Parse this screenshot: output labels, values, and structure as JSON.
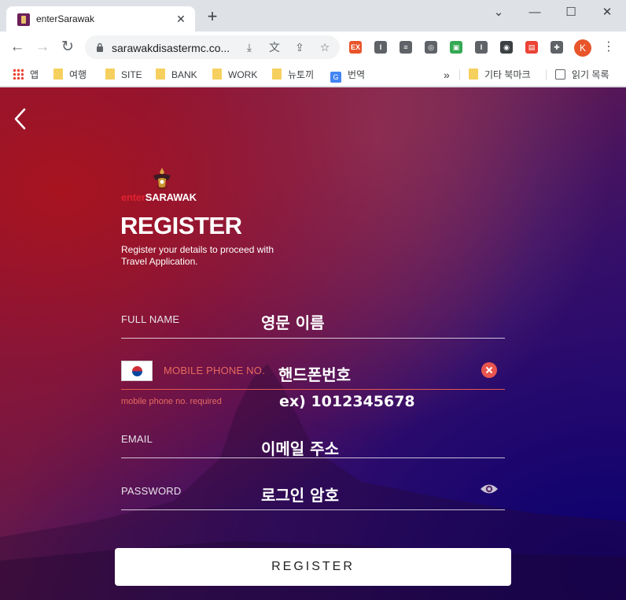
{
  "browser": {
    "tab_title": "enterSarawak",
    "tab_close": "✕",
    "new_tab": "+",
    "url": "sarawakdisastermc.co...",
    "window_minimize": "—",
    "window_maximize": "☐",
    "window_close": "✕",
    "profile_initial": "K",
    "extensions": [
      {
        "icon": "ex-icon",
        "label": "EX",
        "color": "#e8552b"
      },
      {
        "icon": "i-icon",
        "label": "I",
        "color": "#5f6368"
      },
      {
        "icon": "list-icon",
        "label": "≡",
        "color": "#5f6368"
      },
      {
        "icon": "film-icon",
        "label": "◎",
        "color": "#5f6368"
      },
      {
        "icon": "screen-icon",
        "label": "▣",
        "color": "#34a853"
      },
      {
        "icon": "i2-icon",
        "label": "I",
        "color": "#5f6368"
      },
      {
        "icon": "helmet-icon",
        "label": "◉",
        "color": "#3c4043"
      },
      {
        "icon": "cast-icon",
        "label": "▤",
        "color": "#ea4335"
      },
      {
        "icon": "puzzle-icon",
        "label": "✚",
        "color": "#5f6368"
      }
    ]
  },
  "bookmarks": {
    "items": [
      {
        "label": "앱",
        "icon": "apps-icon"
      },
      {
        "label": "여행",
        "icon": "folder-icon"
      },
      {
        "label": "SITE",
        "icon": "folder-icon"
      },
      {
        "label": "BANK",
        "icon": "folder-icon"
      },
      {
        "label": "WORK",
        "icon": "folder-icon"
      },
      {
        "label": "뉴토끼",
        "icon": "folder-icon"
      },
      {
        "label": "번역",
        "icon": "translate-icon"
      }
    ],
    "overflow": "»",
    "other_bookmarks": "기타 북마크",
    "reading_list": "읽기 목록"
  },
  "page": {
    "logo_enter": "enter",
    "logo_sarawak": "SARAWAK",
    "title": "REGISTER",
    "subtitle": "Register your details to proceed with Travel Application.",
    "full_name": {
      "label": "FULL NAME",
      "value": "영문 이름"
    },
    "mobile": {
      "label": "MOBILE PHONE NO.",
      "value": "핸드폰번호",
      "error": "mobile phone no. required",
      "hint": "ex) 1012345678",
      "country": "KR"
    },
    "email": {
      "label": "EMAIL",
      "value": "이메일 주소"
    },
    "password": {
      "label": "PASSWORD",
      "value": "로그인 암호"
    },
    "register_button": "REGISTER"
  },
  "colors": {
    "error": "#e86a60",
    "brand_red": "#e0222e",
    "bg_red": "#8a1230",
    "bg_blue": "#1a0a7a"
  }
}
